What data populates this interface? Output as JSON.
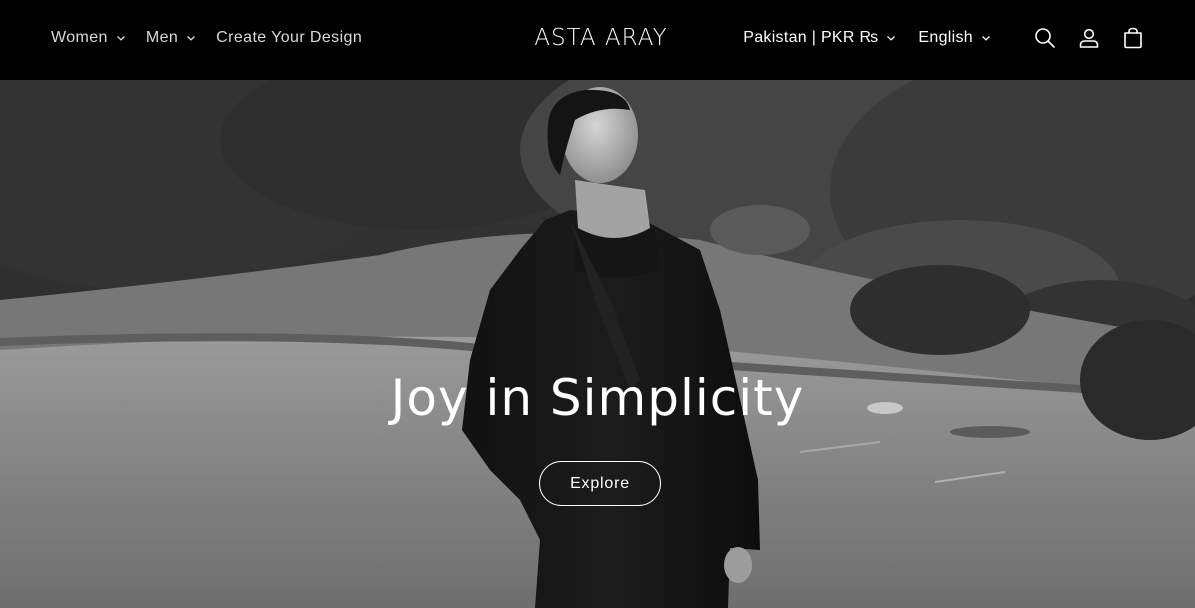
{
  "header": {
    "nav": [
      {
        "label": "Women",
        "has_dropdown": true
      },
      {
        "label": "Men",
        "has_dropdown": true
      },
      {
        "label": "Create Your Design",
        "has_dropdown": false
      }
    ],
    "logo": "ASTA ARAY",
    "country_selector": "Pakistan | PKR ₨",
    "language_selector": "English",
    "icons": [
      "search-icon",
      "account-icon",
      "cart-icon"
    ]
  },
  "hero": {
    "heading": "Joy in Simplicity",
    "button_label": "Explore",
    "image_description_style": "grayscale"
  },
  "colors": {
    "header_bg": "#000000",
    "text": "#ffffff",
    "nav_text": "#d9d9d9"
  }
}
